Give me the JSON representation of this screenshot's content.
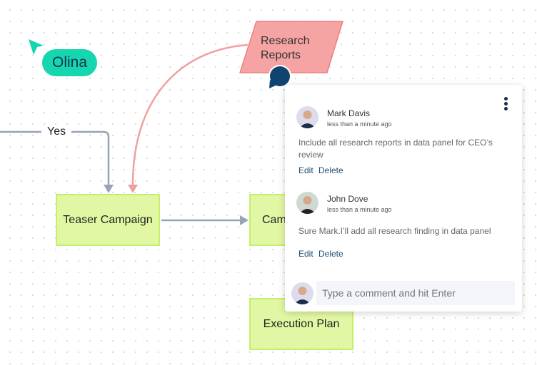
{
  "canvas": {
    "collaborator": {
      "name": "Olina",
      "color": "#16d6b0"
    },
    "edge_label": "Yes",
    "shapes": {
      "research": "Research Reports",
      "research_line1": "Research",
      "research_line2": "Reports",
      "teaser": "Teaser Campaign",
      "campaign": "Cam",
      "execution": "Execution Plan"
    },
    "colors": {
      "process_fill": "#e1f7a3",
      "data_fill": "#f5a3a3",
      "connector": "#98a3b8",
      "data_connector": "#f0a0a0"
    }
  },
  "comments_panel": {
    "comments": [
      {
        "author": "Mark Davis",
        "time": "less than a minute ago",
        "text": "Include all research reports in data panel for CEO’s review",
        "edit": "Edit",
        "delete": "Delete"
      },
      {
        "author": "John Dove",
        "time": "less than a minute ago",
        "text": "Sure Mark.I’ll add all research finding in data panel",
        "edit": "Edit",
        "delete": "Delete"
      }
    ],
    "input_placeholder": "Type a comment and hit Enter"
  }
}
